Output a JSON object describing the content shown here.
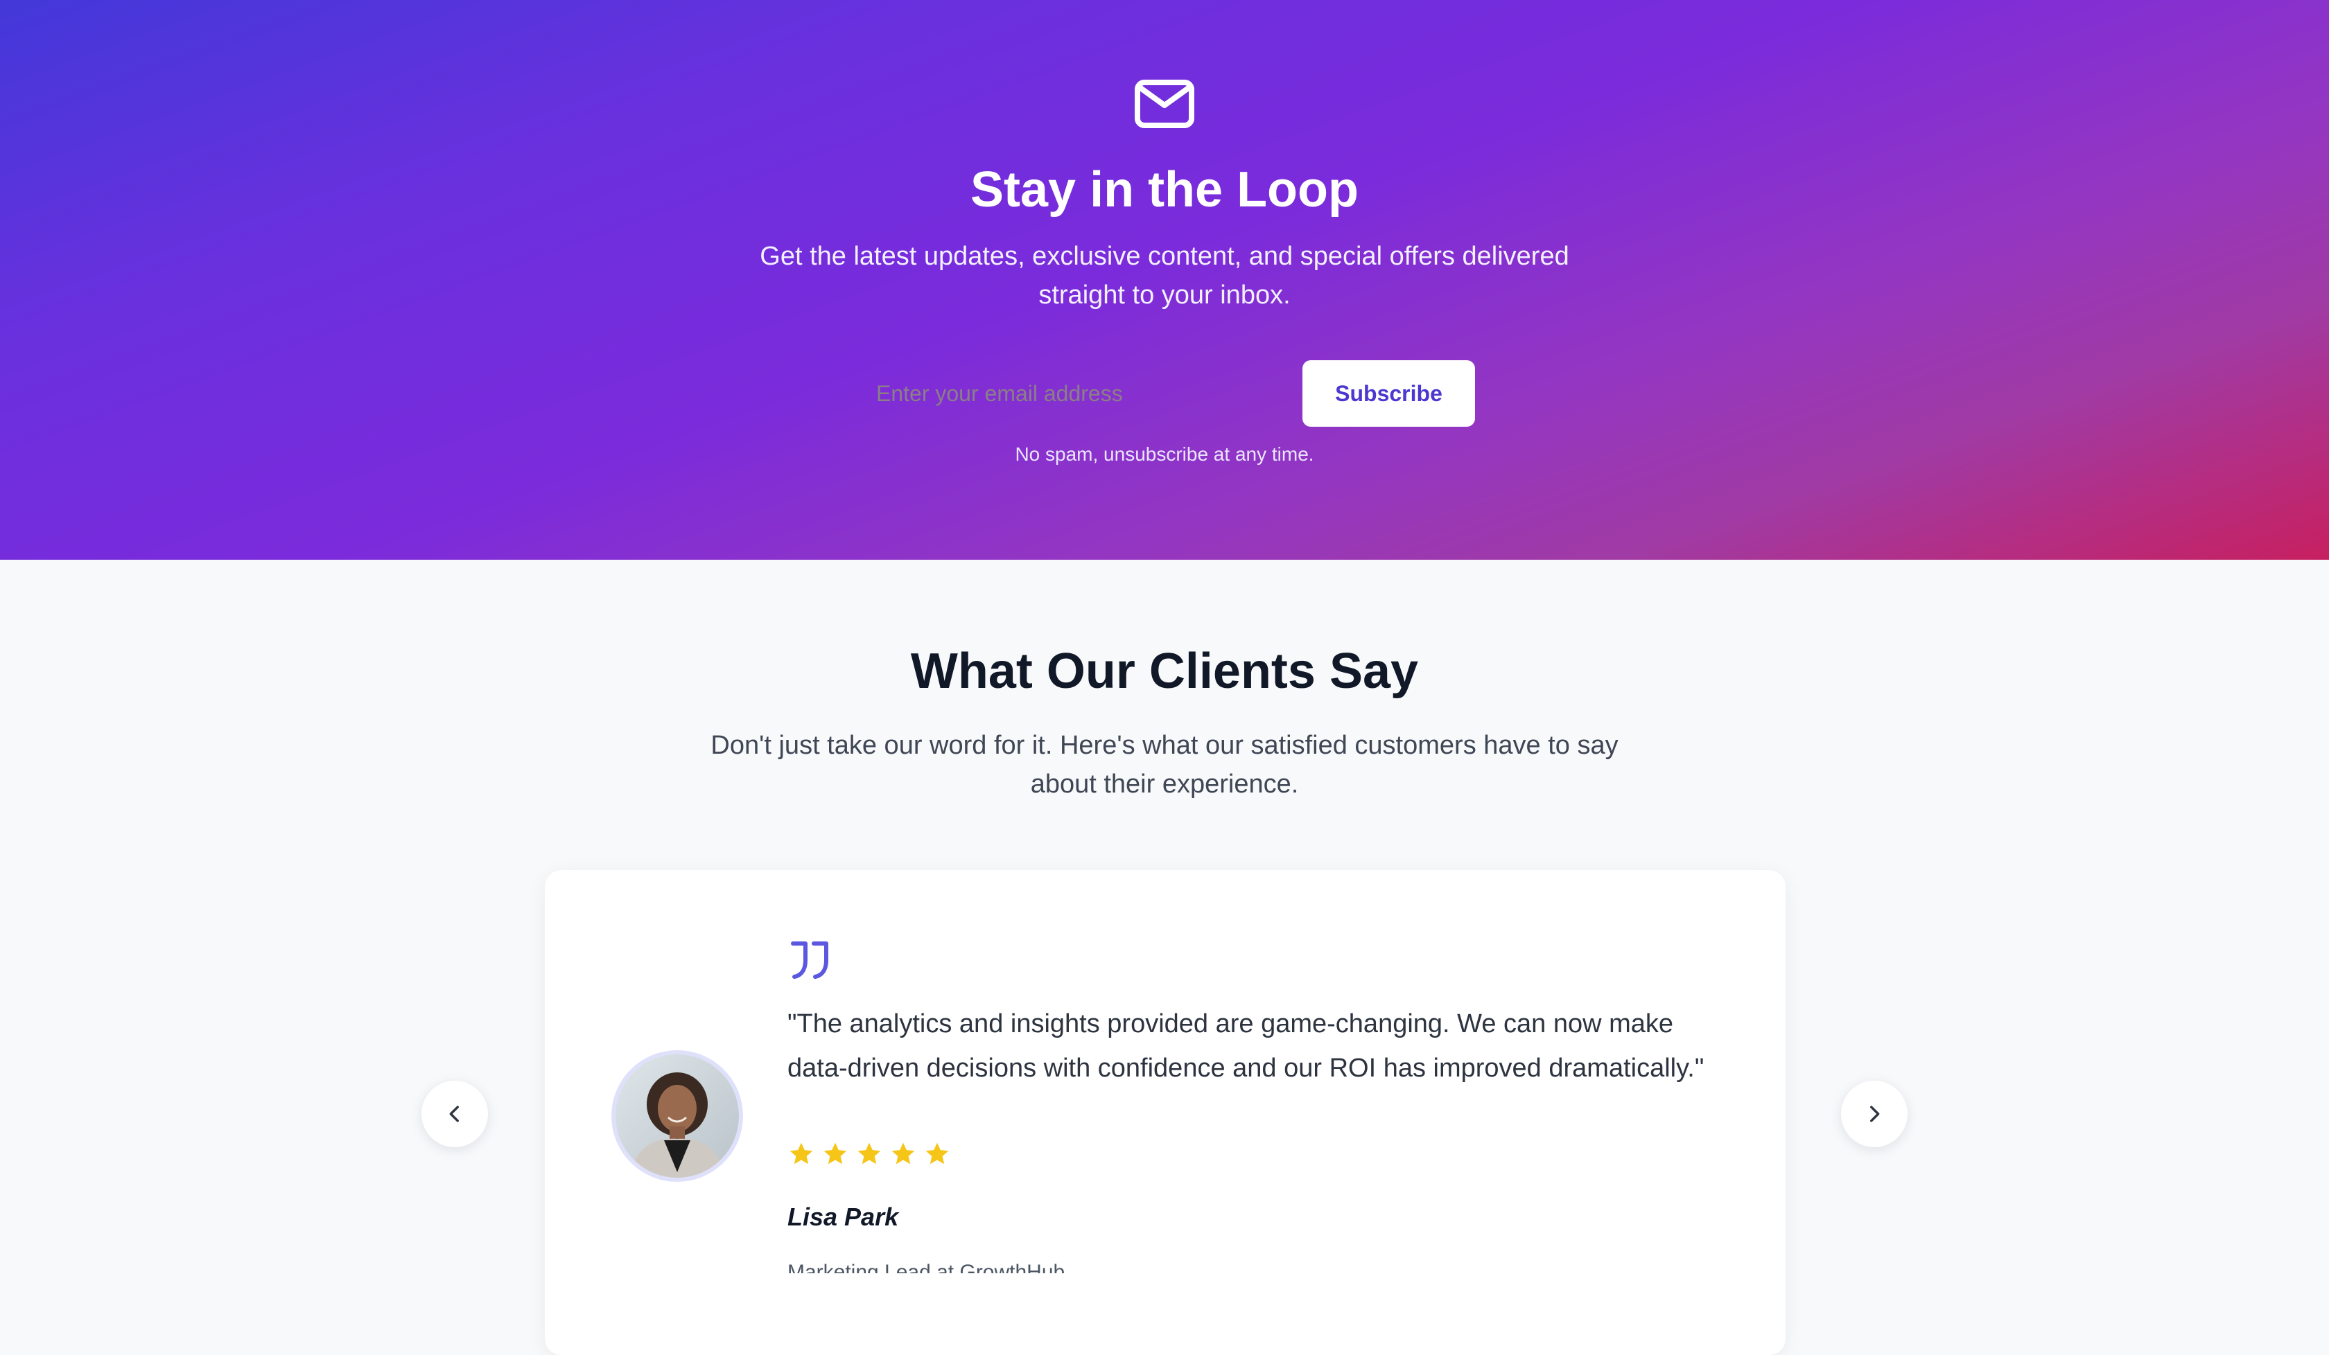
{
  "newsletter": {
    "icon": "mail-icon",
    "title": "Stay in the Loop",
    "subtitle": "Get the latest updates, exclusive content, and special offers delivered straight to your inbox.",
    "email_placeholder": "Enter your email address",
    "email_value": "",
    "subscribe_label": "Subscribe",
    "disclaimer": "No spam, unsubscribe at any time.",
    "colors": {
      "gradient_start": "#4338d9",
      "gradient_mid": "#7b2bdb",
      "gradient_end": "#c72060",
      "button_text": "#4b38d0"
    }
  },
  "testimonials": {
    "title": "What Our Clients Say",
    "subtitle": "Don't just take our word for it. Here's what our satisfied customers have to say about their experience.",
    "prev_icon": "chevron-left-icon",
    "next_icon": "chevron-right-icon",
    "current": {
      "quote_icon": "quote-icon",
      "quote": "\"The analytics and insights provided are game-changing. We can now make data-driven decisions with confidence and our ROI has improved dramatically.\"",
      "rating": 5,
      "rating_max": 5,
      "name": "Lisa Park",
      "role": "Marketing Lead at GrowthHub",
      "colors": {
        "accent": "#5b57e0",
        "star": "#f5c518"
      }
    }
  }
}
